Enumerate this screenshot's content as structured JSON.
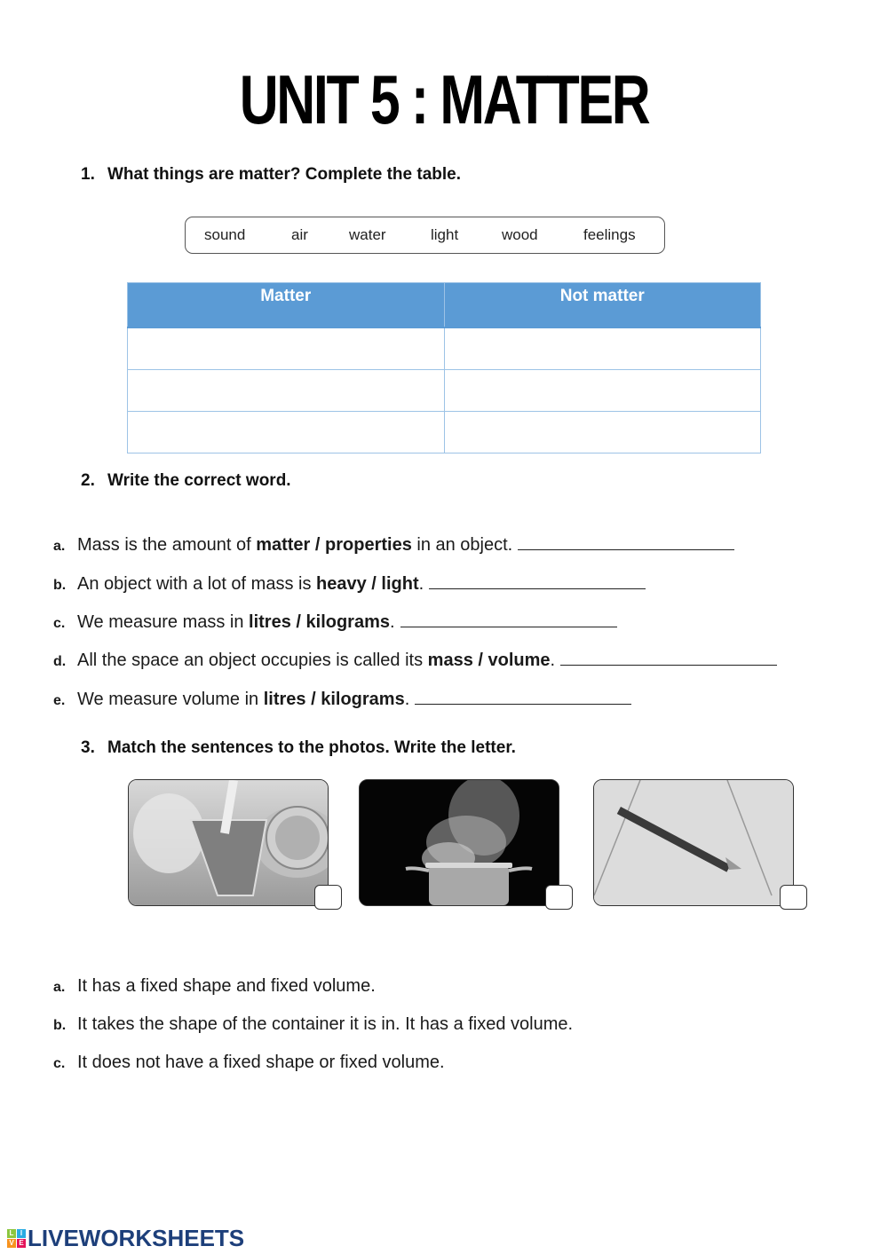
{
  "title": "UNIT 5 : MATTER",
  "section1": {
    "number": "1.",
    "heading": "What things are matter? Complete the table.",
    "word_bank": [
      "sound",
      "air",
      "water",
      "light",
      "wood",
      "feelings"
    ],
    "table": {
      "headers": [
        "Matter",
        "Not matter"
      ],
      "rows": [
        [
          "",
          ""
        ],
        [
          "",
          ""
        ],
        [
          "",
          ""
        ]
      ],
      "header_color": "#5b9bd5"
    }
  },
  "section2": {
    "number": "2.",
    "heading": "Write the correct word.",
    "items": [
      {
        "letter": "a.",
        "pre": "Mass is the amount of ",
        "opt1": "matter",
        "sep": " / ",
        "opt2": "properties",
        "post": " in an object.",
        "answer": ""
      },
      {
        "letter": "b.",
        "pre": "An object with a lot of mass is ",
        "opt1": "heavy",
        "sep": " / ",
        "opt2": "light",
        "post": ".",
        "answer": ""
      },
      {
        "letter": "c.",
        "pre": "We measure mass in ",
        "opt1": "litres",
        "sep": " / ",
        "opt2": "kilograms",
        "post": ".",
        "answer": ""
      },
      {
        "letter": "d.",
        "pre": "All the space an object occupies is called its ",
        "opt1": "mass",
        "sep": " / ",
        "opt2": "volume",
        "post": ".",
        "answer": ""
      },
      {
        "letter": "e.",
        "pre": "We measure volume in ",
        "opt1": "litres",
        "sep": " / ",
        "opt2": "kilograms",
        "post": ".",
        "answer": ""
      }
    ]
  },
  "section3": {
    "number": "3.",
    "heading": "Match the sentences to the photos. Write the letter.",
    "photos": [
      {
        "subject": "juice-glass-photo",
        "answer": ""
      },
      {
        "subject": "steaming-pot-photo",
        "answer": ""
      },
      {
        "subject": "pencil-photo",
        "answer": ""
      }
    ],
    "sentences": [
      {
        "letter": "a.",
        "text": "It has a fixed shape and fixed volume."
      },
      {
        "letter": "b.",
        "text": "It takes the shape of the container it is in. It has a fixed volume."
      },
      {
        "letter": "c.",
        "text": "It does not have a fixed shape or fixed volume."
      }
    ]
  },
  "footer": {
    "logo_letters": [
      "L",
      "I",
      "V",
      "E"
    ],
    "logo_colors": [
      "#8cc63f",
      "#29abe2",
      "#f7931e",
      "#e4145a"
    ],
    "brand": "LIVEWORKSHEETS"
  }
}
